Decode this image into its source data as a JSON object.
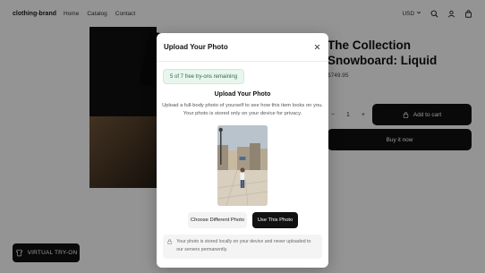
{
  "header": {
    "brand": "clothing-brand",
    "nav": [
      "Home",
      "Catalog",
      "Contact"
    ],
    "currency": "USD",
    "icons": [
      "chevron-down-icon",
      "search-icon",
      "user-icon",
      "bag-icon"
    ]
  },
  "product": {
    "title_line1": "The Collection",
    "title_line2": "Snowboard: Liquid",
    "price": "$749.95",
    "quantity": "1",
    "minus": "−",
    "plus": "+",
    "add_to_cart": "Add to cart",
    "buy_now": "Buy it now"
  },
  "virtual_tryon": {
    "label": "VIRTUAL TRY-ON"
  },
  "modal": {
    "title": "Upload Your Photo",
    "badge": "5 of 7 free try-ons remaining",
    "subtitle": "Upload Your Photo",
    "description": "Upload a full-body photo of yourself to see how this item looks on you. Your photo is stored only on your device for privacy.",
    "buttons": {
      "change": "Choose Different Photo",
      "use": "Use This Photo"
    },
    "notice": "Your photo is stored locally on your device and never uploaded to our servers permanently."
  },
  "colors": {
    "accent": "#111111",
    "badge_bg": "#e9f6ee",
    "badge_text": "#2e6a45",
    "overlay": "rgba(0,0,0,0.42)"
  }
}
